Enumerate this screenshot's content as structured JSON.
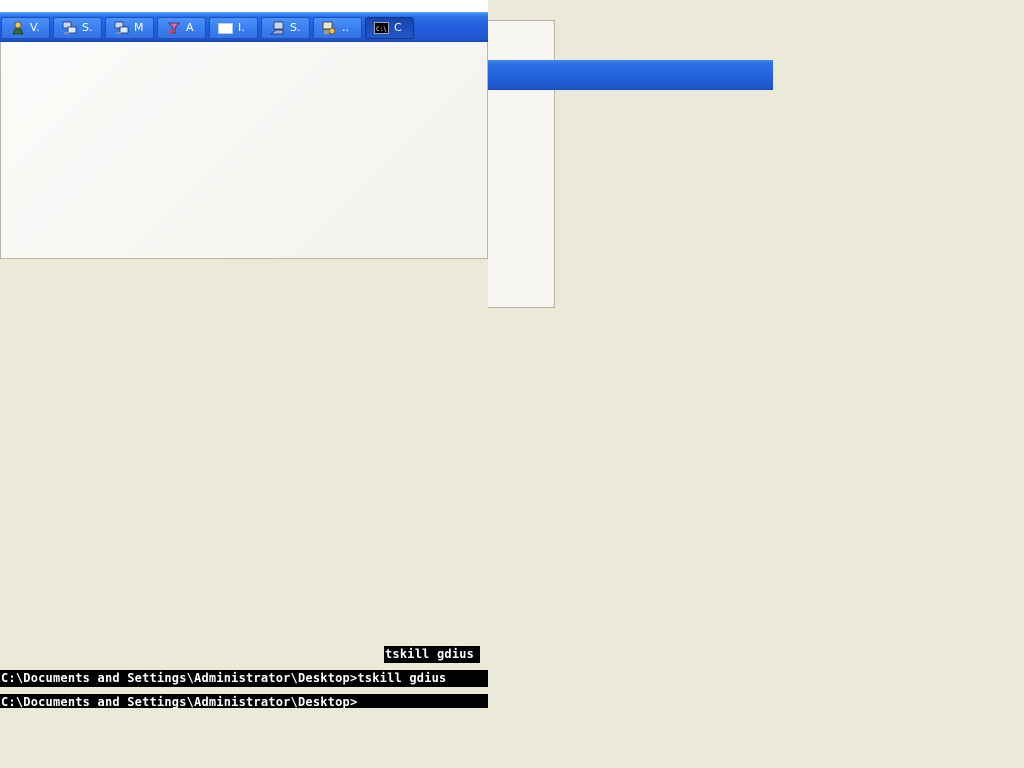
{
  "taskbar": {
    "buttons": [
      {
        "label": "V.",
        "icon": "user-icon",
        "active": false
      },
      {
        "label": "S.",
        "icon": "network-computers-icon",
        "active": false
      },
      {
        "label": "M",
        "icon": "network-computers-icon",
        "active": false
      },
      {
        "label": "A",
        "icon": "tools-icon",
        "active": false
      },
      {
        "label": "I.",
        "icon": "blank-window-icon",
        "active": false
      },
      {
        "label": "S.",
        "icon": "computer-icon",
        "active": false
      },
      {
        "label": "..",
        "icon": "services-icon",
        "active": false
      },
      {
        "label": "C",
        "icon": "command-prompt-icon",
        "active": true
      }
    ],
    "cmd_icon_text": "C:\\"
  },
  "console": {
    "line1": "tskill gdius",
    "line2": "C:\\Documents and Settings\\Administrator\\Desktop>tskill gdius",
    "line3": "C:\\Documents and Settings\\Administrator\\Desktop>"
  },
  "colors": {
    "desktop": "#ebe9d8",
    "taskbar_blue": "#245edc",
    "console_bg": "#000000",
    "console_fg": "#ffffff"
  }
}
